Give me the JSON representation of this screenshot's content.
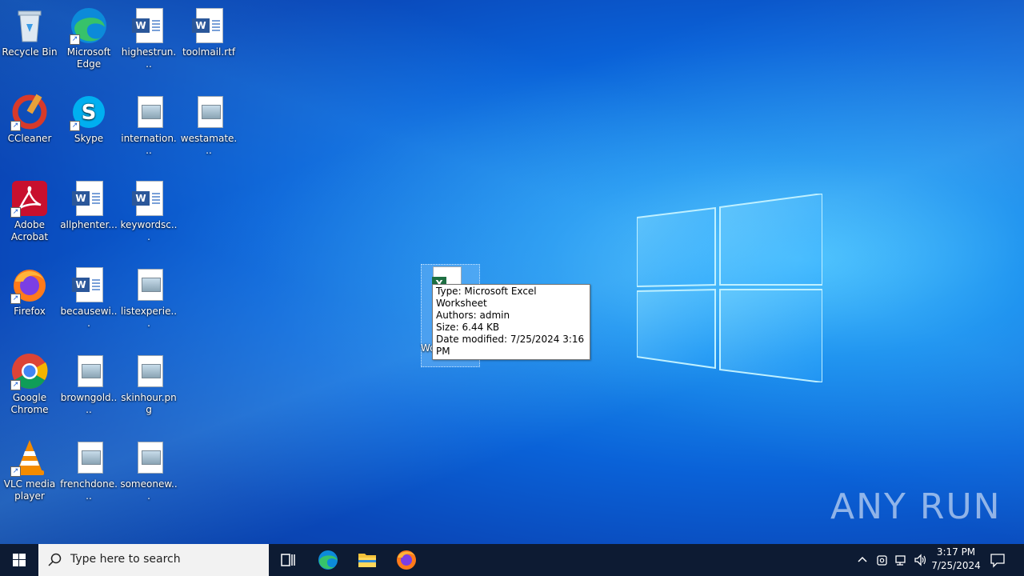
{
  "desktop": {
    "icons": [
      {
        "label": "Recycle Bin"
      },
      {
        "label": "Microsoft Edge"
      },
      {
        "label": "highestrun..."
      },
      {
        "label": "toolmail.rtf"
      },
      {
        "label": "CCleaner"
      },
      {
        "label": "Skype"
      },
      {
        "label": "internation..."
      },
      {
        "label": "westamate..."
      },
      {
        "label": "Adobe Acrobat"
      },
      {
        "label": "allphenter..."
      },
      {
        "label": "keywordsc..."
      },
      {
        "label": "Firefox"
      },
      {
        "label": "becausewi..."
      },
      {
        "label": "listexperie..."
      },
      {
        "label": "Google Chrome"
      },
      {
        "label": "browngold...."
      },
      {
        "label": "skinhour.png"
      },
      {
        "label": "VLC media player"
      },
      {
        "label": "frenchdone..."
      },
      {
        "label": "someonew..."
      }
    ],
    "selected_icon": {
      "label": "Excel Worksheet.xlsx"
    },
    "tooltip": {
      "type": "Type: Microsoft Excel Worksheet",
      "authors": "Authors: admin",
      "size": "Size: 6.44 KB",
      "modified": "Date modified: 7/25/2024 3:16 PM"
    },
    "watermark": "ANY RUN"
  },
  "taskbar": {
    "search_placeholder": "Type here to search",
    "clock_time": "3:17 PM",
    "clock_date": "7/25/2024"
  }
}
